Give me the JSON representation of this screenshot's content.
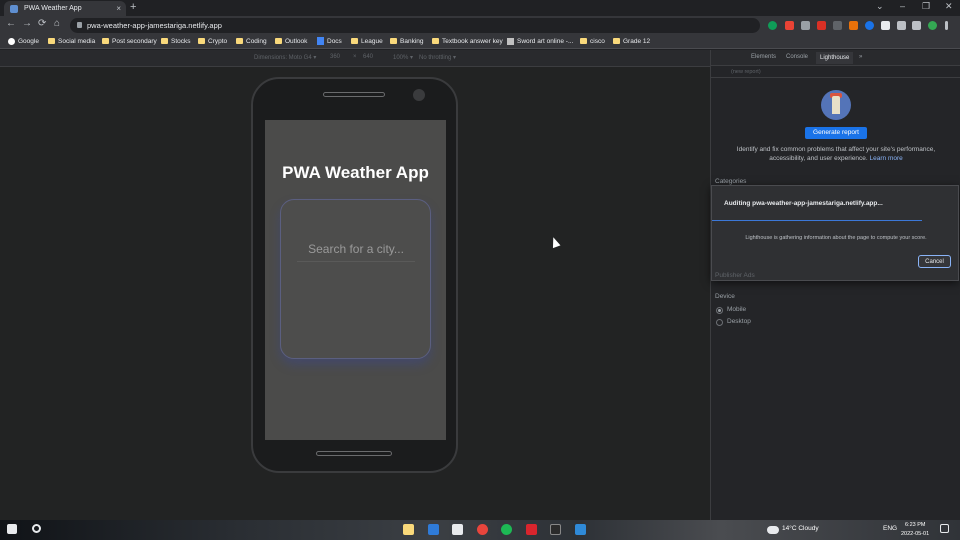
{
  "browser": {
    "tab_title": "PWA Weather App",
    "new_tab_symbol": "+",
    "tab_close_symbol": "×",
    "window_controls": [
      "⌄",
      "–",
      "❐",
      "✕"
    ],
    "nav": {
      "back": "←",
      "forward": "→",
      "reload": "⟳",
      "home": "⌂"
    },
    "url": "pwa-weather-app-jamestariga.netlify.app",
    "bookmarks": [
      "Google",
      "Social media",
      "Post secondary",
      "Stocks",
      "Crypto",
      "Coding",
      "Outlook",
      "Docs",
      "League",
      "Banking",
      "Textbook answer key",
      "Sword art online -...",
      "cisco",
      "Grade 12"
    ]
  },
  "device_toolbar": {
    "dimensions_label": "Dimensions: Moto G4 ▾",
    "width": "360",
    "times": "×",
    "height": "640",
    "zoom": "100% ▾",
    "throttle": "No throttling ▾"
  },
  "app": {
    "title": "PWA Weather App",
    "search_placeholder": "Search for a city..."
  },
  "devtools": {
    "tabs": [
      "Elements",
      "Console",
      "Lighthouse"
    ],
    "active_tab": "Lighthouse",
    "more_tabs": "»",
    "report_selector": "(new report)",
    "generate_button": "Generate report",
    "description": "Identify and fix common problems that affect your site's performance, accessibility, and user experience.",
    "learn_more": "Learn more",
    "categories_label": "Categories",
    "dialog": {
      "title": "Auditing pwa-weather-app-jamestariga.netlify.app...",
      "message": "Lighthouse is gathering information about the page to compute your score.",
      "cancel": "Cancel"
    },
    "publisher_ads": "Publisher Ads",
    "device_label": "Device",
    "device_options": [
      "Mobile",
      "Desktop"
    ],
    "device_selected": "Mobile"
  },
  "taskbar": {
    "weather": "14°C  Cloudy",
    "language": "ENG",
    "time": "6:23 PM",
    "date": "2022-05-01"
  },
  "colors": {
    "accent": "#1a73e8",
    "app_screen": "#4b4b4a",
    "card_border": "#5b5f80"
  }
}
